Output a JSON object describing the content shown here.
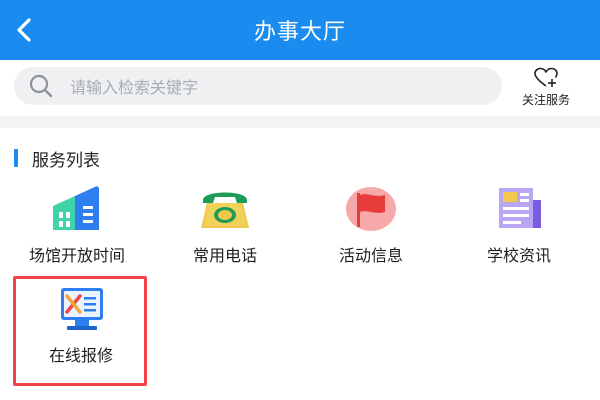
{
  "header": {
    "title": "办事大厅",
    "back_icon": "chevron-left-icon"
  },
  "search": {
    "placeholder": "请输入检索关键字",
    "icon": "search-icon"
  },
  "follow": {
    "label": "关注服务",
    "icon": "heart-plus-icon"
  },
  "section": {
    "title": "服务列表"
  },
  "services": [
    {
      "label": "场馆开放时间",
      "icon": "building-icon"
    },
    {
      "label": "常用电话",
      "icon": "telephone-icon"
    },
    {
      "label": "活动信息",
      "icon": "flag-icon"
    },
    {
      "label": "学校资讯",
      "icon": "newspaper-icon"
    },
    {
      "label": "在线报修",
      "icon": "repair-tools-icon",
      "highlighted": true
    }
  ],
  "colors": {
    "brand": "#1a8cf0",
    "highlight": "#f0434b"
  }
}
